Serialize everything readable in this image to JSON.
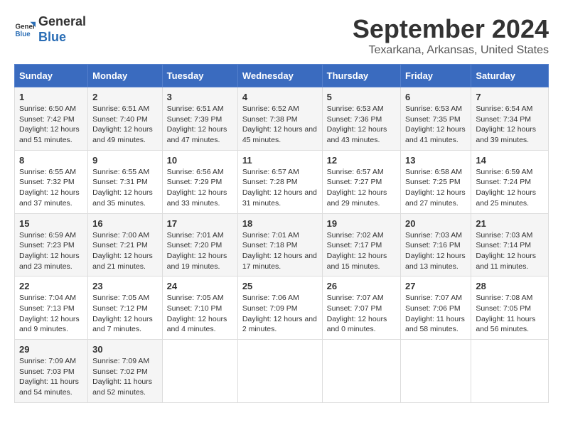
{
  "logo": {
    "line1": "General",
    "line2": "Blue"
  },
  "title": "September 2024",
  "subtitle": "Texarkana, Arkansas, United States",
  "header_accent": "#3a6bbf",
  "days_of_week": [
    "Sunday",
    "Monday",
    "Tuesday",
    "Wednesday",
    "Thursday",
    "Friday",
    "Saturday"
  ],
  "weeks": [
    [
      {
        "day": "1",
        "sunrise": "6:50 AM",
        "sunset": "7:42 PM",
        "daylight": "12 hours and 51 minutes."
      },
      {
        "day": "2",
        "sunrise": "6:51 AM",
        "sunset": "7:40 PM",
        "daylight": "12 hours and 49 minutes."
      },
      {
        "day": "3",
        "sunrise": "6:51 AM",
        "sunset": "7:39 PM",
        "daylight": "12 hours and 47 minutes."
      },
      {
        "day": "4",
        "sunrise": "6:52 AM",
        "sunset": "7:38 PM",
        "daylight": "12 hours and 45 minutes."
      },
      {
        "day": "5",
        "sunrise": "6:53 AM",
        "sunset": "7:36 PM",
        "daylight": "12 hours and 43 minutes."
      },
      {
        "day": "6",
        "sunrise": "6:53 AM",
        "sunset": "7:35 PM",
        "daylight": "12 hours and 41 minutes."
      },
      {
        "day": "7",
        "sunrise": "6:54 AM",
        "sunset": "7:34 PM",
        "daylight": "12 hours and 39 minutes."
      }
    ],
    [
      {
        "day": "8",
        "sunrise": "6:55 AM",
        "sunset": "7:32 PM",
        "daylight": "12 hours and 37 minutes."
      },
      {
        "day": "9",
        "sunrise": "6:55 AM",
        "sunset": "7:31 PM",
        "daylight": "12 hours and 35 minutes."
      },
      {
        "day": "10",
        "sunrise": "6:56 AM",
        "sunset": "7:29 PM",
        "daylight": "12 hours and 33 minutes."
      },
      {
        "day": "11",
        "sunrise": "6:57 AM",
        "sunset": "7:28 PM",
        "daylight": "12 hours and 31 minutes."
      },
      {
        "day": "12",
        "sunrise": "6:57 AM",
        "sunset": "7:27 PM",
        "daylight": "12 hours and 29 minutes."
      },
      {
        "day": "13",
        "sunrise": "6:58 AM",
        "sunset": "7:25 PM",
        "daylight": "12 hours and 27 minutes."
      },
      {
        "day": "14",
        "sunrise": "6:59 AM",
        "sunset": "7:24 PM",
        "daylight": "12 hours and 25 minutes."
      }
    ],
    [
      {
        "day": "15",
        "sunrise": "6:59 AM",
        "sunset": "7:23 PM",
        "daylight": "12 hours and 23 minutes."
      },
      {
        "day": "16",
        "sunrise": "7:00 AM",
        "sunset": "7:21 PM",
        "daylight": "12 hours and 21 minutes."
      },
      {
        "day": "17",
        "sunrise": "7:01 AM",
        "sunset": "7:20 PM",
        "daylight": "12 hours and 19 minutes."
      },
      {
        "day": "18",
        "sunrise": "7:01 AM",
        "sunset": "7:18 PM",
        "daylight": "12 hours and 17 minutes."
      },
      {
        "day": "19",
        "sunrise": "7:02 AM",
        "sunset": "7:17 PM",
        "daylight": "12 hours and 15 minutes."
      },
      {
        "day": "20",
        "sunrise": "7:03 AM",
        "sunset": "7:16 PM",
        "daylight": "12 hours and 13 minutes."
      },
      {
        "day": "21",
        "sunrise": "7:03 AM",
        "sunset": "7:14 PM",
        "daylight": "12 hours and 11 minutes."
      }
    ],
    [
      {
        "day": "22",
        "sunrise": "7:04 AM",
        "sunset": "7:13 PM",
        "daylight": "12 hours and 9 minutes."
      },
      {
        "day": "23",
        "sunrise": "7:05 AM",
        "sunset": "7:12 PM",
        "daylight": "12 hours and 7 minutes."
      },
      {
        "day": "24",
        "sunrise": "7:05 AM",
        "sunset": "7:10 PM",
        "daylight": "12 hours and 4 minutes."
      },
      {
        "day": "25",
        "sunrise": "7:06 AM",
        "sunset": "7:09 PM",
        "daylight": "12 hours and 2 minutes."
      },
      {
        "day": "26",
        "sunrise": "7:07 AM",
        "sunset": "7:07 PM",
        "daylight": "12 hours and 0 minutes."
      },
      {
        "day": "27",
        "sunrise": "7:07 AM",
        "sunset": "7:06 PM",
        "daylight": "11 hours and 58 minutes."
      },
      {
        "day": "28",
        "sunrise": "7:08 AM",
        "sunset": "7:05 PM",
        "daylight": "11 hours and 56 minutes."
      }
    ],
    [
      {
        "day": "29",
        "sunrise": "7:09 AM",
        "sunset": "7:03 PM",
        "daylight": "11 hours and 54 minutes."
      },
      {
        "day": "30",
        "sunrise": "7:09 AM",
        "sunset": "7:02 PM",
        "daylight": "11 hours and 52 minutes."
      },
      null,
      null,
      null,
      null,
      null
    ]
  ]
}
